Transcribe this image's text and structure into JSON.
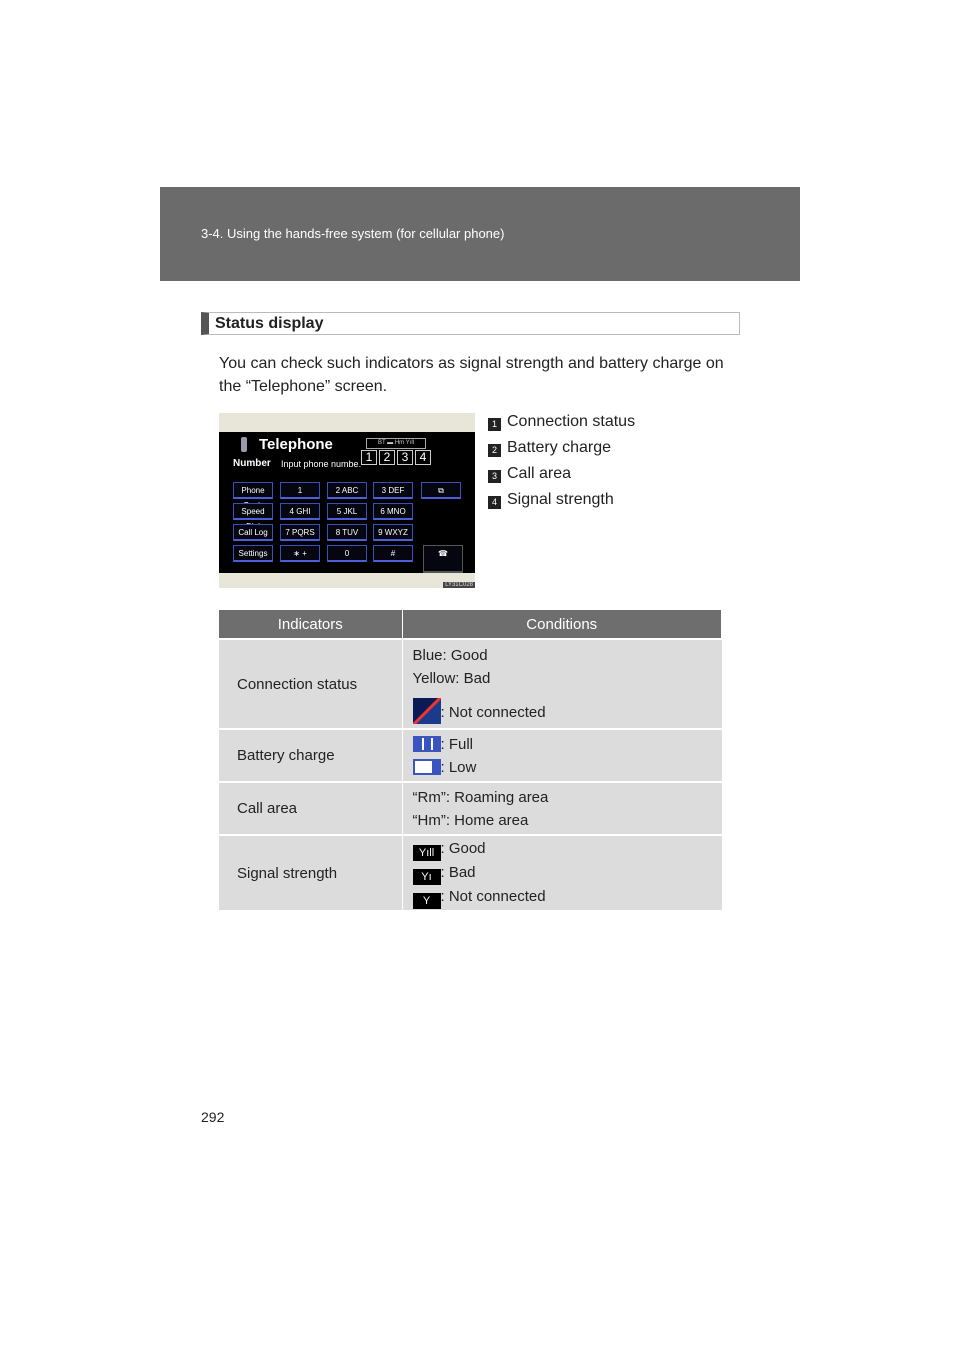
{
  "header": {
    "section": "3-4. Using the hands-free system (for cellular phone)"
  },
  "section_title": "Status display",
  "intro": "You can check such indicators as signal strength and battery charge on the “Telephone” screen.",
  "screenshot": {
    "title": "Telephone",
    "number_label": "Number",
    "input_placeholder": "Input phone numbe.",
    "status": "BT ▬ Hm Yıll",
    "callouts": [
      "1",
      "2",
      "3",
      "4"
    ],
    "keys": [
      "Phone Book",
      "1",
      "2 ABC",
      "3 DEF",
      "⧉",
      "Speed Dial",
      "4 GHI",
      "5 JKL",
      "6 MNO",
      "Call Log",
      "7 PQRS",
      "8 TUV",
      "9 WXYZ",
      "Settings",
      "∗ +",
      "0",
      "#",
      "☎"
    ],
    "code": "LY31C028"
  },
  "legend": [
    {
      "n": "1",
      "label": "Connection status"
    },
    {
      "n": "2",
      "label": "Battery charge"
    },
    {
      "n": "3",
      "label": "Call area"
    },
    {
      "n": "4",
      "label": "Signal strength"
    }
  ],
  "table": {
    "headers": [
      "Indicators",
      "Conditions"
    ],
    "rows": [
      {
        "indicator": "Connection status",
        "lines": [
          "Blue: Good",
          "Yellow: Bad",
          ": Not connected"
        ]
      },
      {
        "indicator": "Battery charge",
        "lines": [
          ": Full",
          ": Low"
        ]
      },
      {
        "indicator": "Call area",
        "lines": [
          "“Rm”: Roaming area",
          "“Hm”: Home area"
        ]
      },
      {
        "indicator": "Signal strength",
        "lines": [
          ": Good",
          ": Bad",
          ": Not connected"
        ]
      }
    ]
  },
  "page_number": "292"
}
